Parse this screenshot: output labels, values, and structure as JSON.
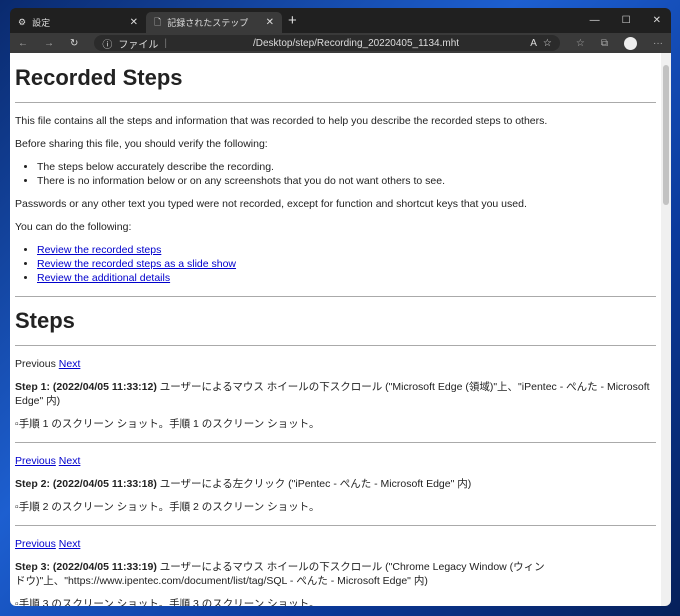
{
  "browser": {
    "tabs": [
      {
        "label": "設定",
        "icon": "gear-icon"
      },
      {
        "label": "記録されたステップ",
        "icon": "page-icon"
      }
    ],
    "address_prefix": "ファイル",
    "url": "/Desktop/step/Recording_20220405_1134.mht"
  },
  "page": {
    "title": "Recorded Steps",
    "intro": "This file contains all the steps and information that was recorded to help you describe the recorded steps to others.",
    "verify": "Before sharing this file, you should verify the following:",
    "verify_items": [
      "The steps below accurately describe the recording.",
      "There is no information below or on any screenshots that you do not want others to see."
    ],
    "passwords": "Passwords or any other text you typed were not recorded, except for function and shortcut keys that you used.",
    "can_do": "You can do the following:",
    "links": [
      "Review the recorded steps",
      "Review the recorded steps as a slide show",
      "Review the additional details"
    ],
    "steps_title": "Steps",
    "previous": "Previous",
    "next": "Next",
    "steps": [
      {
        "head": "Step 1: (2022/04/05 11:33:12)",
        "text": " ユーザーによるマウス ホイールの下スクロール (\"Microsoft Edge (領域)\"上、\"iPentec - ぺんた - Microsoft Edge\" 内)",
        "img": "手順 1 のスクリーン ショット。手順 1 のスクリーン ショット。"
      },
      {
        "head": "Step 2: (2022/04/05 11:33:18)",
        "text": " ユーザーによる左クリック (\"iPentec - ぺんた - Microsoft Edge\" 内)",
        "img": "手順 2 のスクリーン ショット。手順 2 のスクリーン ショット。"
      },
      {
        "head": "Step 3: (2022/04/05 11:33:19)",
        "text": " ユーザーによるマウス ホイールの下スクロール (\"Chrome Legacy Window (ウィンドウ)\"上、\"https://www.ipentec.com/document/list/tag/SQL - ぺんた - Microsoft Edge\" 内)",
        "img": "手順 3 のスクリーン ショット。手順 3 のスクリーン ショット。"
      }
    ]
  }
}
